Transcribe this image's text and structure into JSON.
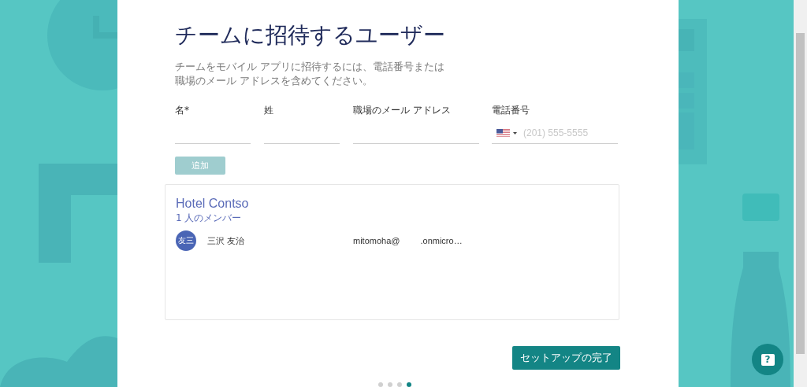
{
  "title": "チームに招待するユーザー",
  "description": [
    "チームをモバイル アプリに招待するには、電話番号または",
    "職場のメール アドレスを含めてください。"
  ],
  "form": {
    "fields": [
      {
        "kind": "text",
        "label": "名*"
      },
      {
        "kind": "text",
        "label": "姓"
      },
      {
        "kind": "text",
        "label": "職場のメール アドレス"
      },
      {
        "kind": "phone",
        "label": "電話番号",
        "placeholder": "(201) 555-5555"
      }
    ],
    "add_button": {
      "label": "追加",
      "disabled": true
    }
  },
  "team": {
    "name": "Hotel Contso",
    "member_count": "1 人のメンバー",
    "members": [
      {
        "initials": "友三",
        "name": "三沢 友治",
        "email": [
          "mitomoha@",
          ".onmicro…"
        ]
      }
    ]
  },
  "finish_button": {
    "label": "セットアップの完了"
  },
  "pager": [
    {
      "selected": false
    },
    {
      "selected": false
    },
    {
      "selected": false
    },
    {
      "selected": true
    }
  ],
  "help_button": {
    "label": "?"
  }
}
